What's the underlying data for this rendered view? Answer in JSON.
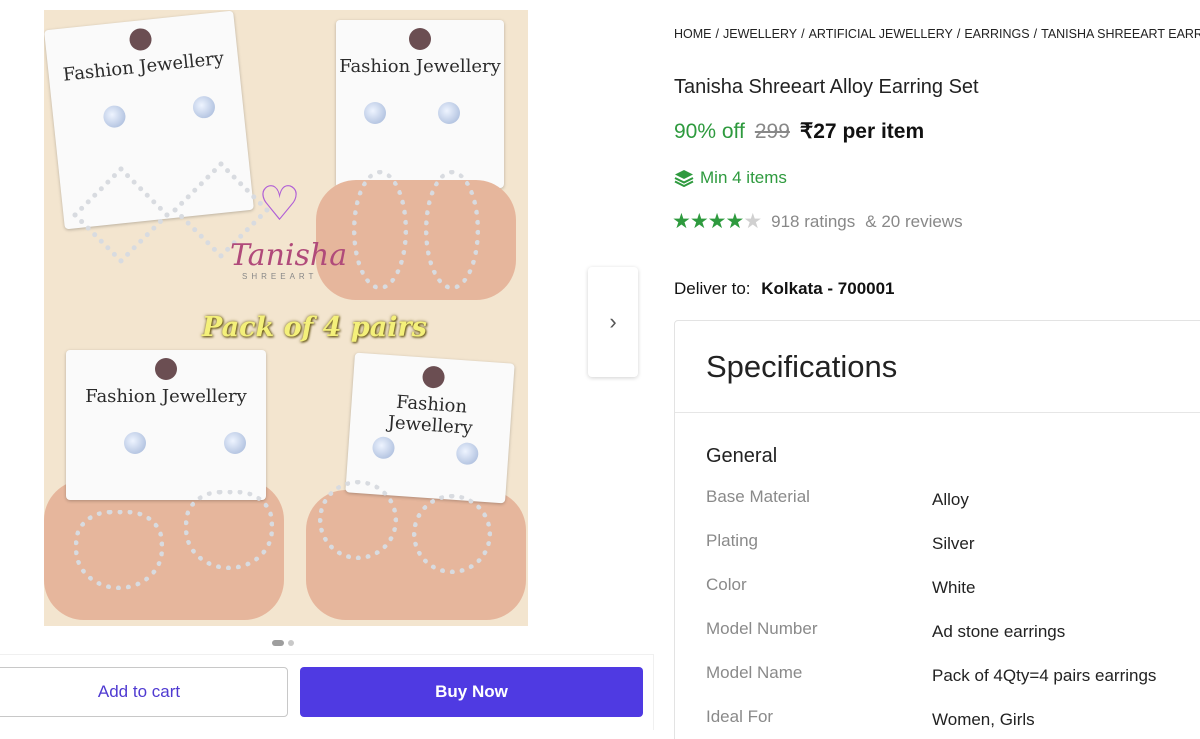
{
  "breadcrumb": {
    "home": "HOME",
    "jewellery": "JEWELLERY",
    "artificial": "ARTIFICIAL JEWELLERY",
    "earrings": "EARRINGS",
    "current": "TANISHA SHREEART EARR"
  },
  "product": {
    "title": "Tanisha Shreeart Alloy Earring Set",
    "discount": "90% off",
    "mrp": "299",
    "price": "₹27 per item",
    "min_items": "Min 4 items",
    "rating_stars": 4,
    "ratings": "918 ratings",
    "reviews": "& 20 reviews"
  },
  "delivery": {
    "label": "Deliver to:",
    "location": "Kolkata - 700001"
  },
  "gallery": {
    "card_brand": "Fashion Jewellery",
    "overlay_text": "Pack of 4 pairs",
    "logo_text": "Tanisha",
    "logo_sub": "SHREEART",
    "slides": 2,
    "active_slide": 0
  },
  "actions": {
    "add_to_cart": "Add to cart",
    "buy_now": "Buy Now"
  },
  "specifications": {
    "title": "Specifications",
    "section": "General",
    "rows": [
      {
        "key": "Base Material",
        "value": "Alloy"
      },
      {
        "key": "Plating",
        "value": "Silver"
      },
      {
        "key": "Color",
        "value": "White"
      },
      {
        "key": "Model Number",
        "value": "Ad stone earrings"
      },
      {
        "key": "Model Name",
        "value": "Pack of 4Qty=4 pairs earrings"
      },
      {
        "key": "Ideal For",
        "value": "Women, Girls"
      }
    ]
  },
  "colors": {
    "accent": "#4f3ae2",
    "green": "#2e9a3e"
  }
}
